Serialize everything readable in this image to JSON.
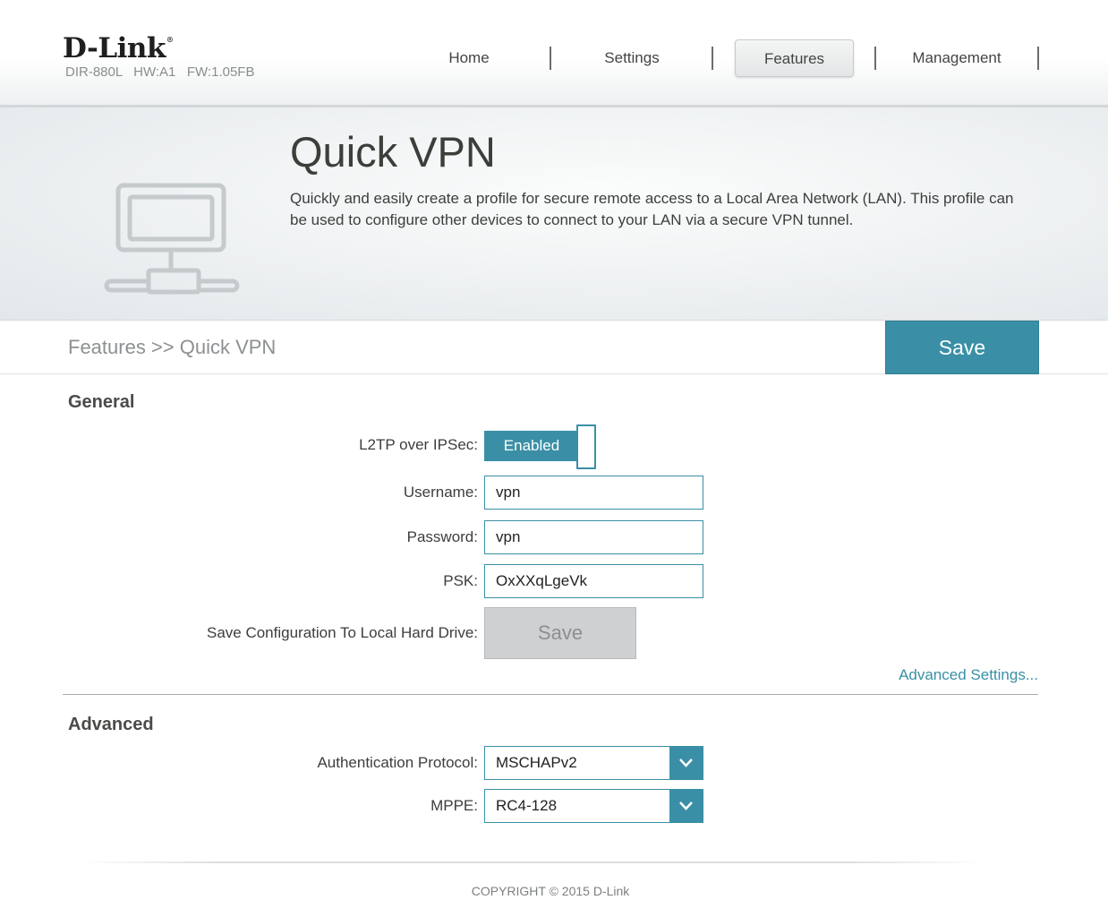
{
  "header": {
    "logo": "D-Link",
    "hw_info": "DIR-880L   HW:A1   FW:1.05FB",
    "nav": [
      {
        "label": "Home"
      },
      {
        "label": "Settings"
      },
      {
        "label": "Features",
        "active": true
      },
      {
        "label": "Management"
      }
    ]
  },
  "hero": {
    "icon": "computer-network-icon",
    "title": "Quick VPN",
    "description": "Quickly and easily create a profile for secure remote access to a Local Area Network (LAN). This profile can be used to configure other devices to connect to your LAN via a secure VPN tunnel."
  },
  "breadcrumb": "Features >> Quick VPN",
  "save_button": "Save",
  "general": {
    "title": "General",
    "l2tp_label": "L2TP over IPSec:",
    "l2tp_state": "Enabled",
    "username_label": "Username:",
    "username_value": "vpn",
    "password_label": "Password:",
    "password_value": "vpn",
    "psk_label": "PSK:",
    "psk_value": "OxXXqLgeVk",
    "save_config_label": "Save Configuration To Local Hard Drive:",
    "save_config_button": "Save",
    "advanced_link": "Advanced Settings..."
  },
  "advanced": {
    "title": "Advanced",
    "auth_label": "Authentication Protocol:",
    "auth_value": "MSCHAPv2",
    "mppe_label": "MPPE:",
    "mppe_value": "RC4-128"
  },
  "footer": {
    "copyright": "COPYRIGHT © 2015 D-Link"
  },
  "colors": {
    "accent": "#3a8fa6",
    "disabled_button": "#cfd0d1"
  }
}
